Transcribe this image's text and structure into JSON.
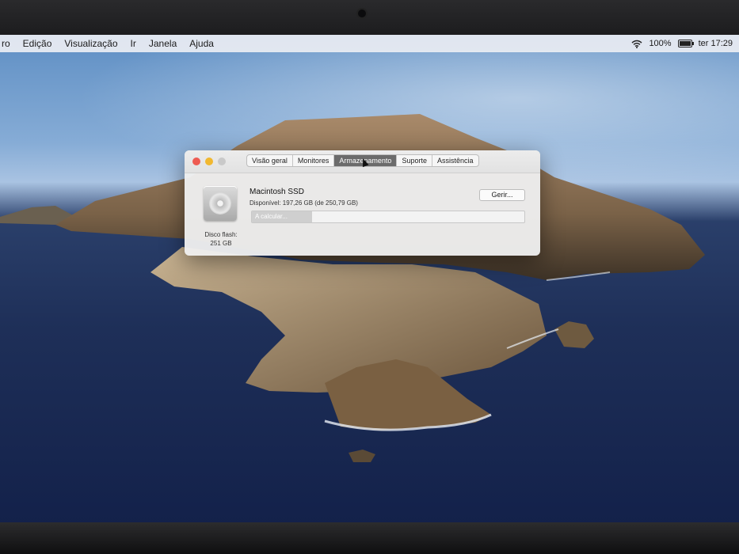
{
  "menubar": {
    "items": [
      "ro",
      "Edição",
      "Visualização",
      "Ir",
      "Janela",
      "Ajuda"
    ],
    "battery_percent": "100%",
    "clock": "ter 17:29"
  },
  "window": {
    "tabs": [
      {
        "label": "Visão geral",
        "active": false
      },
      {
        "label": "Monitores",
        "active": false
      },
      {
        "label": "Armazenamento",
        "active": true
      },
      {
        "label": "Suporte",
        "active": false
      },
      {
        "label": "Assistência",
        "active": false
      }
    ],
    "disk": {
      "name": "Macintosh SSD",
      "available": "Disponível: 197,26 GB (de 250,79 GB)",
      "type_label": "Disco flash:",
      "size": "251 GB",
      "manage_label": "Gerir...",
      "bar_text": "A calcular...",
      "bar_fill_fraction": 0.22
    }
  },
  "icons": {
    "wifi": "wifi-icon",
    "battery": "battery-icon",
    "disk": "hard-disk-icon",
    "cursor": "mouse-pointer-icon"
  }
}
